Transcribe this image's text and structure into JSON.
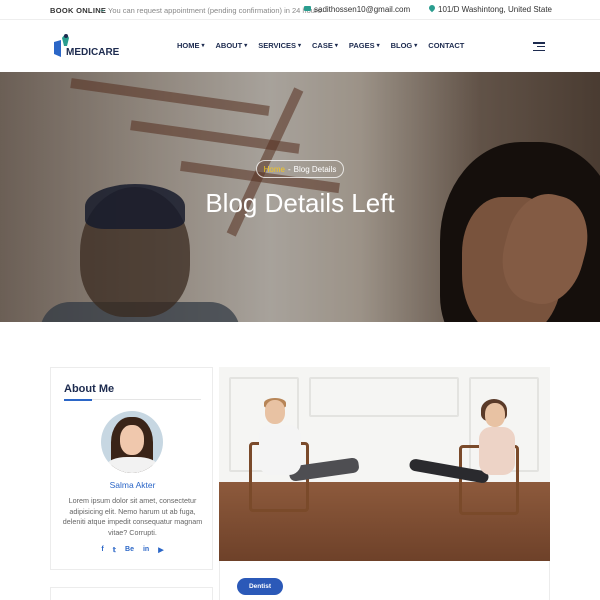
{
  "topbar": {
    "book_label": "BOOK ONLINE",
    "note": "You can request appointment (pending confirmation) in 24 hours",
    "email": "sadithossen10@gmail.com",
    "address": "101/D Washintong, United State"
  },
  "header": {
    "logo_text": "MEDICARE",
    "nav": [
      {
        "label": "HOME",
        "dropdown": true
      },
      {
        "label": "ABOUT",
        "dropdown": true
      },
      {
        "label": "SERVICES",
        "dropdown": true
      },
      {
        "label": "CASE",
        "dropdown": true
      },
      {
        "label": "PAGES",
        "dropdown": true
      },
      {
        "label": "BLOG",
        "dropdown": true
      },
      {
        "label": "CONTACT",
        "dropdown": false
      }
    ]
  },
  "hero": {
    "breadcrumb_home": "Home",
    "breadcrumb_sep": "-",
    "breadcrumb_current": "Blog Details",
    "title": "Blog Details Left"
  },
  "sidebar": {
    "about_title": "About Me",
    "name": "Salma Akter",
    "bio": "Lorem ipsum dolor sit amet, consectetur adipisicing elit. Nemo harum ut ab fuga, deleniti atque impedit consequatur magnam vitae? Corrupti.",
    "social": [
      {
        "icon": "facebook-icon",
        "glyph": "f"
      },
      {
        "icon": "twitter-icon",
        "glyph": "𝕥"
      },
      {
        "icon": "behance-icon",
        "glyph": "Be"
      },
      {
        "icon": "linkedin-icon",
        "glyph": "in"
      },
      {
        "icon": "youtube-icon",
        "glyph": "▶"
      }
    ]
  },
  "post": {
    "tag": "Dentist"
  },
  "colors": {
    "accent": "#2b66c7",
    "teal": "#2a9d8f",
    "navy": "#1d2b4f",
    "breadcrumb_home": "#f3c623"
  }
}
